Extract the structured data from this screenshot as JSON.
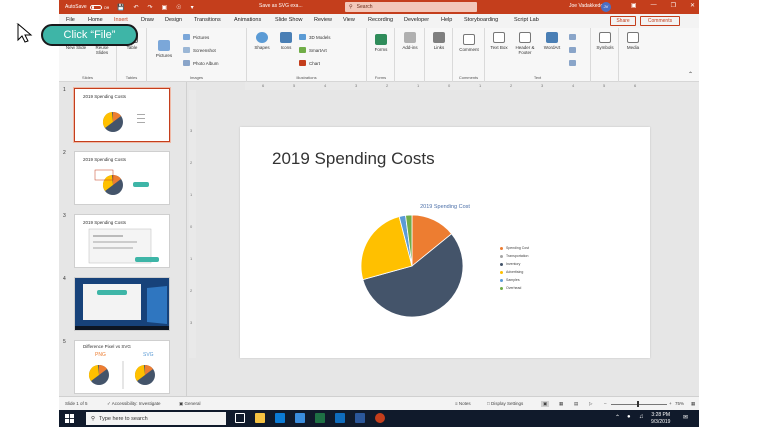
{
  "titlebar": {
    "autosave_label": "AutoSave",
    "autosave_state": "Off",
    "doc_title": "Save as SVG exa...",
    "search_placeholder": "Search",
    "user_name": "Joe Vadakkedom",
    "user_initials": "JV"
  },
  "tabs": [
    "File",
    "Home",
    "Insert",
    "Draw",
    "Design",
    "Transitions",
    "Animations",
    "Slide Show",
    "Review",
    "View",
    "Recording",
    "Developer",
    "Help",
    "Storyboarding",
    "Script Lab"
  ],
  "active_tab": "Insert",
  "share_label": "Share",
  "comments_label": "Comments",
  "ribbon": {
    "groups": {
      "slides": "Slides",
      "tables": "Tables",
      "images": "Images",
      "illustrations": "Illustrations",
      "forms": "Forms",
      "comments": "Comments",
      "text": "Text"
    },
    "new_slide": "New Slide",
    "reuse_slides": "Reuse Slides",
    "table": "Table",
    "pictures": "Pictures",
    "online_pictures": "Pictures",
    "screenshot": "Screenshot",
    "photo_album": "Photo Album",
    "shapes": "Shapes",
    "icons": "Icons",
    "models_3d": "3D Models",
    "smartart": "SmartArt",
    "chart": "Chart",
    "forms": "Forms",
    "addins": "Add-ins",
    "links": "Links",
    "comment": "Comment",
    "text_box": "Text Box",
    "header_footer": "Header & Footer",
    "wordart": "WordArt",
    "symbols": "Symbols",
    "media": "Media"
  },
  "ruler_ticks": [
    "6",
    "5",
    "4",
    "3",
    "2",
    "1",
    "0",
    "1",
    "2",
    "3",
    "4",
    "5",
    "6"
  ],
  "vruler_ticks": [
    "3",
    "2",
    "1",
    "0",
    "1",
    "2",
    "3"
  ],
  "thumbnails": [
    {
      "num": "1",
      "title": "2019 Spending Costs"
    },
    {
      "num": "2",
      "title": "2019 Spending Costs"
    },
    {
      "num": "3",
      "title": "2019 Spending Costs"
    },
    {
      "num": "4",
      "title": ""
    },
    {
      "num": "5",
      "title": "Difference Pixel vs SVG",
      "png": "PNG",
      "svg": "SVG"
    }
  ],
  "slide": {
    "title": "2019 Spending Costs"
  },
  "chart_data": {
    "type": "pie",
    "title": "2019 Spending Cost",
    "categories": [
      "Spending Cost",
      "Transportation",
      "Inventory",
      "Advertising",
      "Samples",
      "Overhead"
    ],
    "values": [
      14,
      0,
      56,
      25,
      2,
      2
    ],
    "colors": [
      "#ed7d31",
      "#a5a5a5",
      "#44546a",
      "#ffc000",
      "#5b9bd5",
      "#70ad47"
    ],
    "legend_position": "right"
  },
  "statusbar": {
    "slide_info": "Slide 1 of 5",
    "accessibility": "Accessibility: Investigate",
    "general": "General",
    "notes": "Notes",
    "display_settings": "Display Settings",
    "zoom": "75%"
  },
  "taskbar": {
    "search_placeholder": "Type here to search",
    "time": "3:28 PM",
    "date": "9/3/2019"
  },
  "callout": {
    "text": "Click “File”"
  }
}
